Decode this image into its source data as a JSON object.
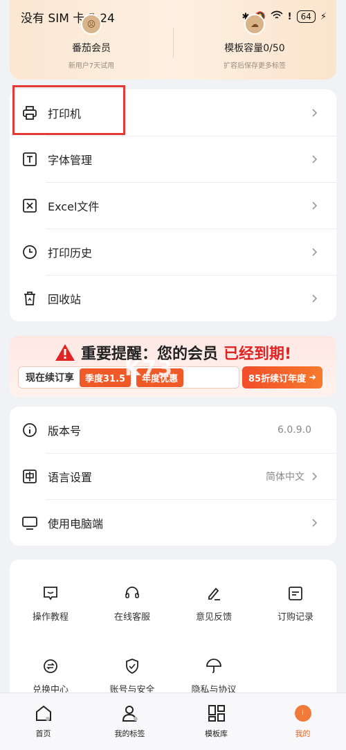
{
  "status_bar": {
    "carrier_time": "没有 SIM 卡 5:24",
    "battery": "64"
  },
  "header": {
    "vip": {
      "title": "番茄会员",
      "subtitle": "新用户7天试用"
    },
    "capacity": {
      "title": "模板容量0/50",
      "subtitle": "扩容后保存更多标签"
    }
  },
  "menu1": [
    {
      "label": "打印机",
      "icon": "printer-icon"
    },
    {
      "label": "字体管理",
      "icon": "font-icon"
    },
    {
      "label": "Excel文件",
      "icon": "excel-icon"
    },
    {
      "label": "打印历史",
      "icon": "clock-icon"
    },
    {
      "label": "回收站",
      "icon": "trash-icon"
    }
  ],
  "banner": {
    "headline_black": "重要提醒：您的会员",
    "headline_red": "已经到期!",
    "renew_label": "现在续订享",
    "offer1": "季度31.5",
    "offer2": "年度优惠",
    "cta": "85折续订年度"
  },
  "watermark": "K73",
  "menu2": [
    {
      "label": "版本号",
      "value": "6.0.9.0",
      "icon": "info-icon",
      "chevron": false
    },
    {
      "label": "语言设置",
      "value": "简体中文",
      "icon": "language-icon",
      "chevron": true
    },
    {
      "label": "使用电脑端",
      "value": "",
      "icon": "monitor-icon",
      "chevron": true
    }
  ],
  "grid": [
    {
      "label": "操作教程",
      "icon": "tutorial-icon"
    },
    {
      "label": "在线客服",
      "icon": "headset-icon"
    },
    {
      "label": "意见反馈",
      "icon": "edit-icon"
    },
    {
      "label": "订购记录",
      "icon": "order-icon"
    },
    {
      "label": "兑换中心",
      "icon": "exchange-icon"
    },
    {
      "label": "账号与安全",
      "icon": "shield-icon"
    },
    {
      "label": "隐私与协议",
      "icon": "umbrella-icon"
    }
  ],
  "tabs": [
    {
      "label": "首页",
      "icon": "home-icon",
      "active": false
    },
    {
      "label": "我的标签",
      "icon": "label-icon",
      "active": false
    },
    {
      "label": "模板库",
      "icon": "template-icon",
      "active": false
    },
    {
      "label": "我的",
      "icon": "mine-icon",
      "active": true
    }
  ],
  "colors": {
    "accent": "#e8611a",
    "alert_red": "#e02424",
    "highlight_box": "#e53935"
  }
}
